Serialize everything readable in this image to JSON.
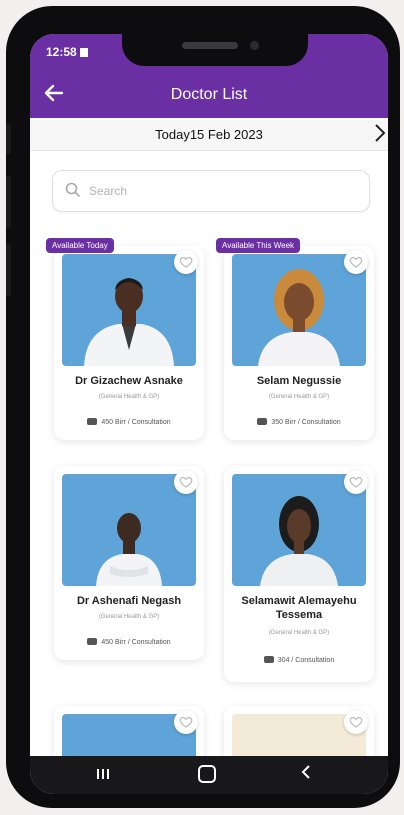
{
  "status_bar": {
    "time": "12:58"
  },
  "header": {
    "title": "Doctor List",
    "back_icon": "arrow-left-icon"
  },
  "date_bar": {
    "date": "Today15 Feb 2023",
    "next_icon": "chevron-right-icon"
  },
  "search": {
    "placeholder": "Search",
    "value": ""
  },
  "doctors": [
    {
      "badge": "Available Today",
      "name": "Dr Gizachew Asnake",
      "name_line2": "",
      "subtitle": "(General Health & GP)",
      "price": "450 Birr / Consultation"
    },
    {
      "badge": "Available This Week",
      "name": "Selam Negussie",
      "name_line2": "",
      "subtitle": "(General Health & GP)",
      "price": "350 Birr / Consultation"
    },
    {
      "badge": "",
      "name": "Dr Ashenafi Negash",
      "name_line2": "",
      "subtitle": "(General Health & GP)",
      "price": "450 Birr / Consultation"
    },
    {
      "badge": "",
      "name": "Selamawit Alemayehu",
      "name_line2": "Tessema",
      "subtitle": "(General Health & GP)",
      "price": "304 / Consultation"
    }
  ],
  "colors": {
    "primary": "#6a2fa3",
    "photo_bg": "#5ea4d8"
  }
}
